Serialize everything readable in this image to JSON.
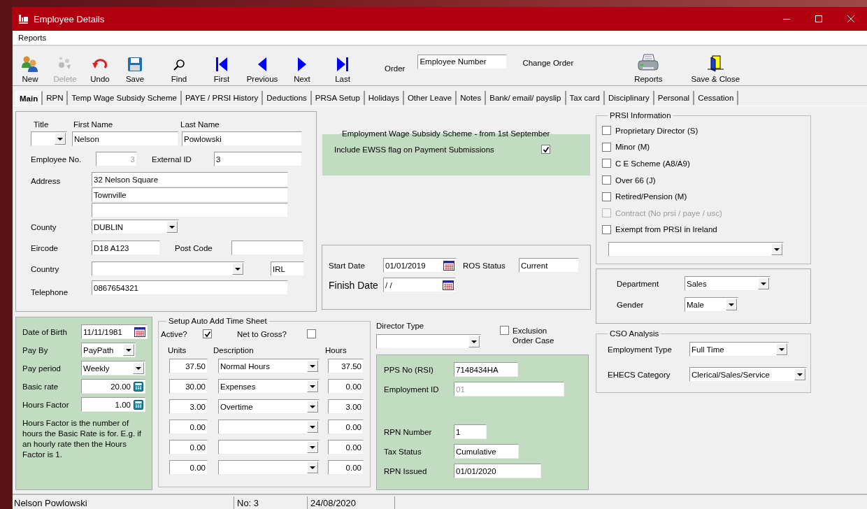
{
  "window": {
    "title": "Employee Details"
  },
  "menu": [
    "Reports"
  ],
  "toolbar": [
    {
      "kind": "new",
      "label": "New",
      "disabled": false
    },
    {
      "kind": "delete",
      "label": "Delete",
      "disabled": true
    },
    {
      "kind": "undo",
      "label": "Undo",
      "disabled": false
    },
    {
      "kind": "save",
      "label": "Save",
      "disabled": false
    },
    {
      "kind": "find",
      "label": "Find",
      "disabled": false
    },
    {
      "kind": "first",
      "label": "First",
      "disabled": false
    },
    {
      "kind": "previous",
      "label": "Previous",
      "disabled": false
    },
    {
      "kind": "next",
      "label": "Next",
      "disabled": false
    },
    {
      "kind": "last",
      "label": "Last",
      "disabled": false
    }
  ],
  "order": {
    "label": "Order",
    "value": "Employee Number",
    "change": "Change Order"
  },
  "toolbar_right": [
    {
      "kind": "reports",
      "label": "Reports"
    },
    {
      "kind": "save_close",
      "label": "Save & Close"
    }
  ],
  "tabs": [
    {
      "label": "Main",
      "selected": true
    },
    {
      "label": "RPN",
      "selected": false
    },
    {
      "label": "Temp Wage Subsidy Scheme",
      "selected": false
    },
    {
      "label": "PAYE / PRSI History",
      "selected": false
    },
    {
      "label": "Deductions",
      "selected": false
    },
    {
      "label": "PRSA Setup",
      "selected": false
    },
    {
      "label": "Holidays",
      "selected": false
    },
    {
      "label": "Other Leave",
      "selected": false
    },
    {
      "label": "Notes",
      "selected": false
    },
    {
      "label": "Bank/ email/ payslip",
      "selected": false
    },
    {
      "label": "Tax card",
      "selected": false
    },
    {
      "label": "Disciplinary",
      "selected": false
    },
    {
      "label": "Personal",
      "selected": false
    },
    {
      "label": "Cessation",
      "selected": false
    }
  ],
  "main": {
    "title": {
      "label": "Title"
    },
    "first_name": {
      "label": "First Name",
      "value": "Nelson"
    },
    "last_name": {
      "label": "Last Name",
      "value": "Powlowski"
    },
    "employee_no": {
      "label": "Employee No.",
      "value": "3",
      "disabled": true
    },
    "external_id": {
      "label": "External ID",
      "value": "3"
    },
    "address": {
      "label": "Address",
      "lines": [
        "32 Nelson Square",
        "Townville"
      ]
    },
    "county": {
      "label": "County",
      "value": "DUBLIN"
    },
    "eircode": {
      "label": "Eircode",
      "value": "D18 A123"
    },
    "post_code": {
      "label": "Post Code"
    },
    "country": {
      "label": "Country",
      "code": "IRL"
    },
    "telephone": {
      "label": "Telephone",
      "value": "0867654321"
    }
  },
  "ewss": {
    "title": "Employment Wage Subsidy Scheme - from 1st September",
    "label": "Include EWSS flag on Payment Submissions",
    "checked": true
  },
  "dates": {
    "start_date": {
      "label": "Start Date",
      "value": "01/01/2019"
    },
    "ros_status": {
      "label": "ROS Status",
      "value": "Current"
    },
    "finish_date": {
      "label": "Finish Date",
      "value": "/ /"
    }
  },
  "prsi": {
    "title": "PRSI Information",
    "items": [
      {
        "label": "Proprietary Director (S)",
        "checked": false,
        "disabled": false
      },
      {
        "label": "Minor (M)",
        "checked": false,
        "disabled": false
      },
      {
        "label": "C E Scheme (A8/A9)",
        "checked": false,
        "disabled": false
      },
      {
        "label": "Over 66 (J)",
        "checked": false,
        "disabled": false
      },
      {
        "label": "Retired/Pension (M)",
        "checked": false,
        "disabled": false
      },
      {
        "label": "Contract (No prsi / paye / usc)",
        "checked": false,
        "disabled": true
      },
      {
        "label": "Exempt from PRSI in Ireland",
        "checked": false,
        "disabled": false
      }
    ]
  },
  "org": {
    "department": {
      "label": "Department",
      "value": "Sales"
    },
    "gender": {
      "label": "Gender",
      "value": "Male"
    }
  },
  "cso": {
    "title": "CSO Analysis",
    "employment_type": {
      "label": "Employment Type",
      "value": "Full Time"
    },
    "ehecs": {
      "label": "EHECS Category",
      "value": "Clerical/Sales/Service"
    }
  },
  "pay": {
    "date_of_birth": {
      "label": "Date of Birth",
      "value": "11/11/1981"
    },
    "pay_by": {
      "label": "Pay By",
      "value": "PayPath"
    },
    "pay_period": {
      "label": "Pay period",
      "value": "Weekly"
    },
    "basic_rate": {
      "label": "Basic rate",
      "value": "20.00"
    },
    "hours_factor": {
      "label": "Hours Factor",
      "value": "1.00"
    },
    "note": "Hours Factor is the number of hours the Basic Rate is for. E.g. if an hourly rate then the Hours Factor is 1."
  },
  "timesheet": {
    "title": "Setup Auto Add Time Sheet",
    "active": {
      "label": "Active?",
      "checked": true
    },
    "net_to_gross": {
      "label": "Net to Gross?",
      "checked": false
    },
    "columns": [
      "Units",
      "Description",
      "Hours"
    ],
    "rows": [
      {
        "units": "37.50",
        "description": "Normal Hours",
        "hours": "37.50"
      },
      {
        "units": "30.00",
        "description": "Expenses",
        "hours": "0.00"
      },
      {
        "units": "3.00",
        "description": "Overtime",
        "hours": "3.00"
      },
      {
        "units": "0.00",
        "hours": "0.00"
      },
      {
        "units": "0.00",
        "hours": "0.00"
      },
      {
        "units": "0.00",
        "hours": "0.00"
      }
    ]
  },
  "director": {
    "label": "Director Type",
    "exclusion": {
      "label": "Exclusion Order Case",
      "checked": false
    }
  },
  "revenue": {
    "pps": {
      "label": "PPS No (RSI)",
      "value": "7148434HA"
    },
    "employment_id": {
      "label": "Employment ID",
      "value": "01",
      "disabled": true
    },
    "rpn_number": {
      "label": "RPN Number",
      "value": "1"
    },
    "tax_status": {
      "label": "Tax Status",
      "value": "Cumulative"
    },
    "rpn_issued": {
      "label": "RPN Issued",
      "value": "01/01/2020"
    }
  },
  "status_bar": [
    "Nelson Powlowski",
    "No: 3",
    "24/08/2020"
  ]
}
